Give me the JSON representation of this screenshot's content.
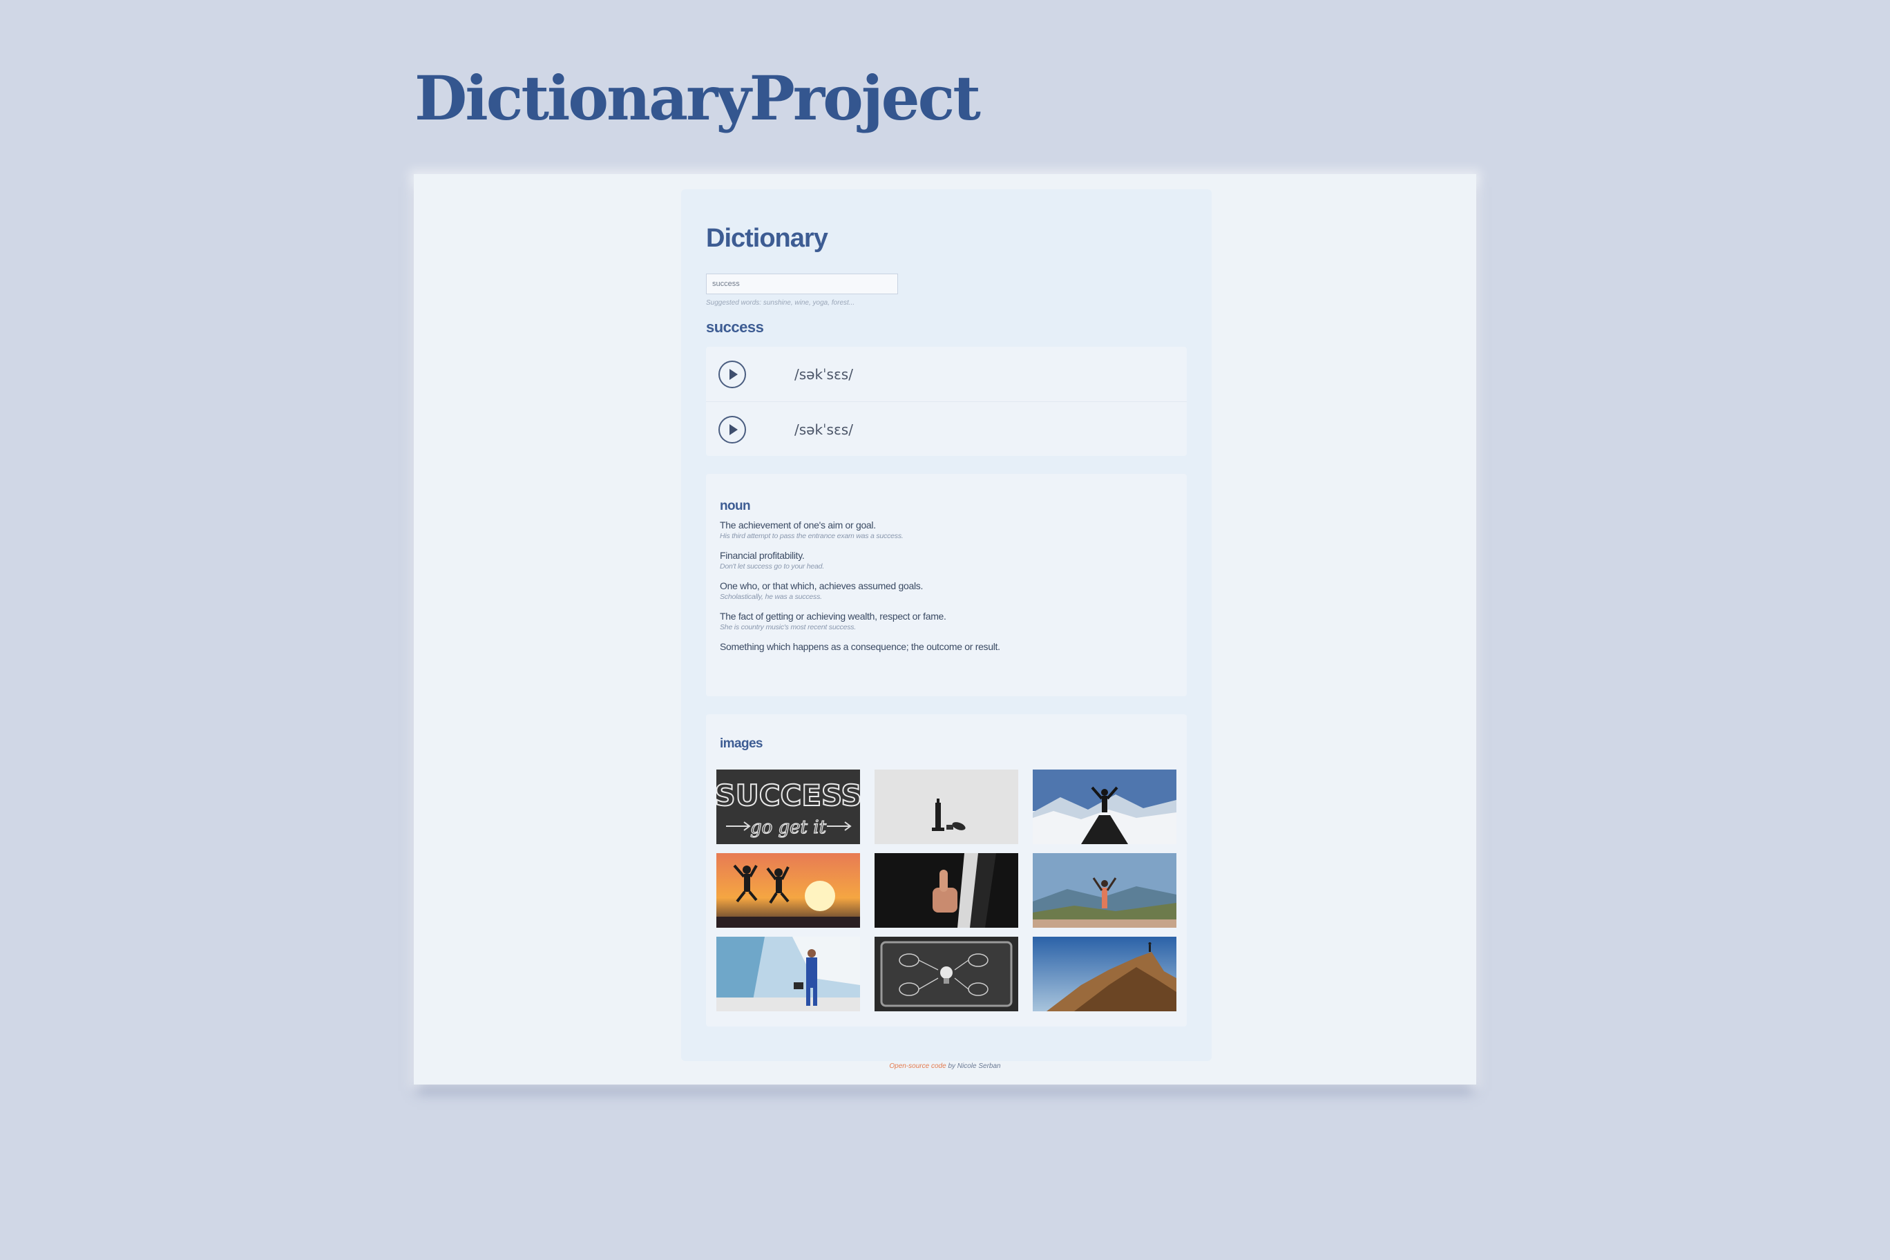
{
  "page": {
    "brand_title": "DictionaryProject"
  },
  "app": {
    "title": "Dictionary",
    "search": {
      "value": "success",
      "placeholder": ""
    },
    "hint": "Suggested words: sunshine, wine, yoga, forest...",
    "word": "success"
  },
  "phonetics": [
    {
      "text": "/səkˈsɛs/",
      "icon": "play-icon"
    },
    {
      "text": "/səkˈsɛs/",
      "icon": "play-icon"
    }
  ],
  "meaning": {
    "part_of_speech": "noun",
    "definitions": [
      {
        "text": "The achievement of one's aim or goal.",
        "example": "His third attempt to pass the entrance exam was a success."
      },
      {
        "text": "Financial profitability.",
        "example": "Don't let success go to your head."
      },
      {
        "text": "One who, or that which, achieves assumed goals.",
        "example": "Scholastically, he was a success."
      },
      {
        "text": "The fact of getting or achieving wealth, respect or fame.",
        "example": "She is country music's most recent success."
      },
      {
        "text": "Something which happens as a consequence; the outcome or result.",
        "example": ""
      }
    ]
  },
  "images": {
    "label": "images",
    "items": [
      {
        "alt": "chalkboard success go get it"
      },
      {
        "alt": "chess king standing over fallen piece"
      },
      {
        "alt": "person arms raised on mountain boardwalk"
      },
      {
        "alt": "two people jumping at sunset"
      },
      {
        "alt": "businessman thumbs up"
      },
      {
        "alt": "hiker arms raised on mountain top"
      },
      {
        "alt": "businessman in blue suit with briefcase"
      },
      {
        "alt": "chalkboard flowchart with lightbulb"
      },
      {
        "alt": "person on rocky summit"
      }
    ],
    "tagline": [
      "SUCCESS",
      "go get it"
    ]
  },
  "footer": {
    "link_text": "Open-source code",
    "by_text": " by Nicole Serban"
  },
  "colors": {
    "accent": "#3d5c93",
    "brand": "#34568f",
    "link": "#e37a4e",
    "background": "#d0d7e6"
  }
}
